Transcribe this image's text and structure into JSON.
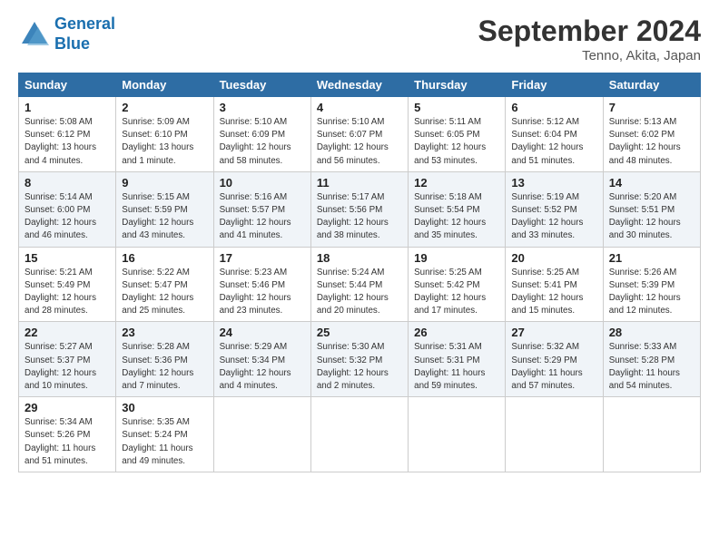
{
  "header": {
    "logo_line1": "General",
    "logo_line2": "Blue",
    "month_title": "September 2024",
    "location": "Tenno, Akita, Japan"
  },
  "weekdays": [
    "Sunday",
    "Monday",
    "Tuesday",
    "Wednesday",
    "Thursday",
    "Friday",
    "Saturday"
  ],
  "weeks": [
    [
      {
        "day": "1",
        "info": "Sunrise: 5:08 AM\nSunset: 6:12 PM\nDaylight: 13 hours\nand 4 minutes."
      },
      {
        "day": "2",
        "info": "Sunrise: 5:09 AM\nSunset: 6:10 PM\nDaylight: 13 hours\nand 1 minute."
      },
      {
        "day": "3",
        "info": "Sunrise: 5:10 AM\nSunset: 6:09 PM\nDaylight: 12 hours\nand 58 minutes."
      },
      {
        "day": "4",
        "info": "Sunrise: 5:10 AM\nSunset: 6:07 PM\nDaylight: 12 hours\nand 56 minutes."
      },
      {
        "day": "5",
        "info": "Sunrise: 5:11 AM\nSunset: 6:05 PM\nDaylight: 12 hours\nand 53 minutes."
      },
      {
        "day": "6",
        "info": "Sunrise: 5:12 AM\nSunset: 6:04 PM\nDaylight: 12 hours\nand 51 minutes."
      },
      {
        "day": "7",
        "info": "Sunrise: 5:13 AM\nSunset: 6:02 PM\nDaylight: 12 hours\nand 48 minutes."
      }
    ],
    [
      {
        "day": "8",
        "info": "Sunrise: 5:14 AM\nSunset: 6:00 PM\nDaylight: 12 hours\nand 46 minutes."
      },
      {
        "day": "9",
        "info": "Sunrise: 5:15 AM\nSunset: 5:59 PM\nDaylight: 12 hours\nand 43 minutes."
      },
      {
        "day": "10",
        "info": "Sunrise: 5:16 AM\nSunset: 5:57 PM\nDaylight: 12 hours\nand 41 minutes."
      },
      {
        "day": "11",
        "info": "Sunrise: 5:17 AM\nSunset: 5:56 PM\nDaylight: 12 hours\nand 38 minutes."
      },
      {
        "day": "12",
        "info": "Sunrise: 5:18 AM\nSunset: 5:54 PM\nDaylight: 12 hours\nand 35 minutes."
      },
      {
        "day": "13",
        "info": "Sunrise: 5:19 AM\nSunset: 5:52 PM\nDaylight: 12 hours\nand 33 minutes."
      },
      {
        "day": "14",
        "info": "Sunrise: 5:20 AM\nSunset: 5:51 PM\nDaylight: 12 hours\nand 30 minutes."
      }
    ],
    [
      {
        "day": "15",
        "info": "Sunrise: 5:21 AM\nSunset: 5:49 PM\nDaylight: 12 hours\nand 28 minutes."
      },
      {
        "day": "16",
        "info": "Sunrise: 5:22 AM\nSunset: 5:47 PM\nDaylight: 12 hours\nand 25 minutes."
      },
      {
        "day": "17",
        "info": "Sunrise: 5:23 AM\nSunset: 5:46 PM\nDaylight: 12 hours\nand 23 minutes."
      },
      {
        "day": "18",
        "info": "Sunrise: 5:24 AM\nSunset: 5:44 PM\nDaylight: 12 hours\nand 20 minutes."
      },
      {
        "day": "19",
        "info": "Sunrise: 5:25 AM\nSunset: 5:42 PM\nDaylight: 12 hours\nand 17 minutes."
      },
      {
        "day": "20",
        "info": "Sunrise: 5:25 AM\nSunset: 5:41 PM\nDaylight: 12 hours\nand 15 minutes."
      },
      {
        "day": "21",
        "info": "Sunrise: 5:26 AM\nSunset: 5:39 PM\nDaylight: 12 hours\nand 12 minutes."
      }
    ],
    [
      {
        "day": "22",
        "info": "Sunrise: 5:27 AM\nSunset: 5:37 PM\nDaylight: 12 hours\nand 10 minutes."
      },
      {
        "day": "23",
        "info": "Sunrise: 5:28 AM\nSunset: 5:36 PM\nDaylight: 12 hours\nand 7 minutes."
      },
      {
        "day": "24",
        "info": "Sunrise: 5:29 AM\nSunset: 5:34 PM\nDaylight: 12 hours\nand 4 minutes."
      },
      {
        "day": "25",
        "info": "Sunrise: 5:30 AM\nSunset: 5:32 PM\nDaylight: 12 hours\nand 2 minutes."
      },
      {
        "day": "26",
        "info": "Sunrise: 5:31 AM\nSunset: 5:31 PM\nDaylight: 11 hours\nand 59 minutes."
      },
      {
        "day": "27",
        "info": "Sunrise: 5:32 AM\nSunset: 5:29 PM\nDaylight: 11 hours\nand 57 minutes."
      },
      {
        "day": "28",
        "info": "Sunrise: 5:33 AM\nSunset: 5:28 PM\nDaylight: 11 hours\nand 54 minutes."
      }
    ],
    [
      {
        "day": "29",
        "info": "Sunrise: 5:34 AM\nSunset: 5:26 PM\nDaylight: 11 hours\nand 51 minutes."
      },
      {
        "day": "30",
        "info": "Sunrise: 5:35 AM\nSunset: 5:24 PM\nDaylight: 11 hours\nand 49 minutes."
      },
      {
        "day": "",
        "info": ""
      },
      {
        "day": "",
        "info": ""
      },
      {
        "day": "",
        "info": ""
      },
      {
        "day": "",
        "info": ""
      },
      {
        "day": "",
        "info": ""
      }
    ]
  ]
}
